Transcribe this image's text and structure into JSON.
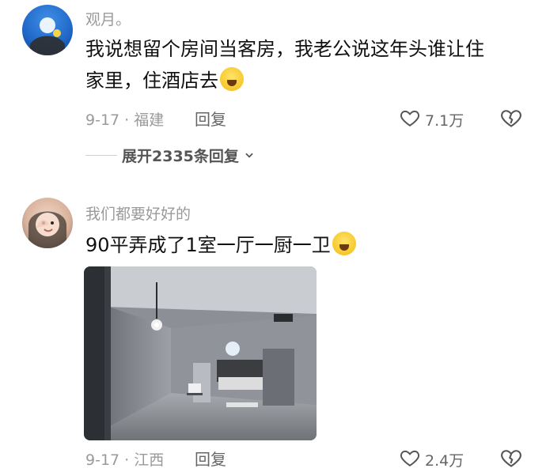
{
  "comments": [
    {
      "username": "观月。",
      "text_line1": "我说想留个房间当客房，我老公说这年头谁让住",
      "text_line2": "家里，住酒店去",
      "emoji": "crying-laughing-face",
      "date": "9-17",
      "location": "福建",
      "reply_label": "回复",
      "likes": "7.1万",
      "expand_label": "展开2335条回复"
    },
    {
      "username": "我们都要好好的",
      "text": "90平弄成了1室一厅一厨一卫",
      "emoji": "crying-laughing-face",
      "date": "9-17",
      "location": "江西",
      "reply_label": "回复",
      "likes": "2.4万",
      "image": "bedroom-photo"
    }
  ],
  "icons": {
    "like": "heart-outline-icon",
    "dislike": "broken-heart-icon",
    "expand": "chevron-down-icon"
  },
  "colors": {
    "meta": "#9a9a9a",
    "text": "#111111"
  }
}
